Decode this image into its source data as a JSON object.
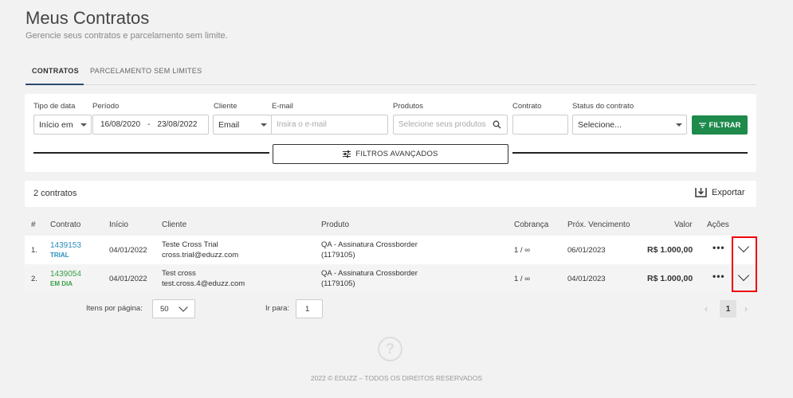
{
  "header": {
    "title": "Meus Contratos",
    "subtitle": "Gerencie seus contratos e parcelamento sem limite."
  },
  "tabs": [
    {
      "label": "CONTRATOS",
      "active": true
    },
    {
      "label": "PARCELAMENTO SEM LIMITES",
      "active": false
    }
  ],
  "filters": {
    "tipo_label": "Tipo de data",
    "tipo_value": "Início em",
    "periodo_label": "Período",
    "periodo_start": "16/08/2020",
    "periodo_sep": "-",
    "periodo_end": "23/08/2022",
    "cliente_label": "Cliente",
    "cliente_value": "Email",
    "email_label": "E-mail",
    "email_placeholder": "Insira o e-mail",
    "produtos_label": "Produtos",
    "produtos_placeholder": "Selecione seus produtos",
    "contrato_label": "Contrato",
    "contrato_value": "",
    "status_label": "Status do contrato",
    "status_value": "Selecione...",
    "filtrar_label": "FILTRAR",
    "advanced_label": "FILTROS AVANÇADOS"
  },
  "results": {
    "count_label": "2 contratos",
    "export_label": "Exportar"
  },
  "table": {
    "headers": [
      "#",
      "Contrato",
      "Início",
      "Cliente",
      "Produto",
      "Cobrança",
      "Próx. Vencimento",
      "Valor",
      "Ações"
    ],
    "rows": [
      {
        "num": "1.",
        "code": "1439153",
        "tag": "TRIAL",
        "tag_color": "#2a8fbd",
        "inicio": "04/01/2022",
        "cliente_nome": "Teste Cross Trial",
        "cliente_email": "cross.trial@eduzz.com",
        "produto_nome": "QA - Assinatura Crossborder",
        "produto_id": "(1179105)",
        "cobranca": "1 / ∞",
        "vencimento": "06/01/2023",
        "valor": "R$ 1.000,00"
      },
      {
        "num": "2.",
        "code": "1439054",
        "tag": "EM DIA",
        "tag_color": "#3aa14a",
        "inicio": "04/01/2022",
        "cliente_nome": "Test cross",
        "cliente_email": "test.cross.4@eduzz.com",
        "produto_nome": "QA - Assinatura Crossborder",
        "produto_id": "(1179105)",
        "cobranca": "1 / ∞",
        "vencimento": "04/01/2023",
        "valor": "R$ 1.000,00"
      }
    ]
  },
  "pagination": {
    "per_page_label": "Itens por página:",
    "per_page_value": "50",
    "goto_label": "Ir para:",
    "goto_value": "1",
    "current_page": "1"
  },
  "footer": {
    "text": "2022 © EDUZZ – TODOS OS DIREITOS RESERVADOS",
    "help_glyph": "?"
  },
  "colors": {
    "accent": "#1e8a4b",
    "link": "#2a8fbd",
    "highlight": "#e00000"
  }
}
